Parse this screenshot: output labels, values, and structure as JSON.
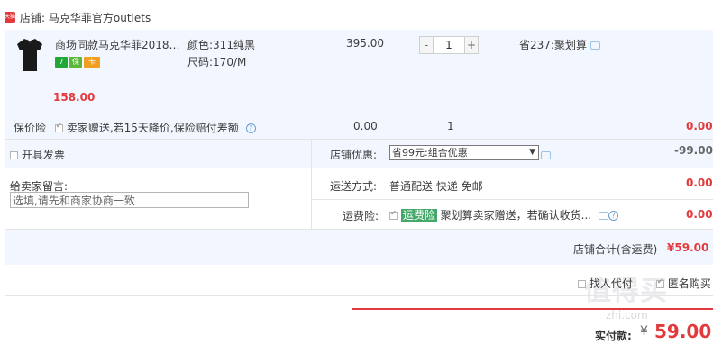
{
  "shop": {
    "icon_text": "天猫",
    "prefix": "店铺:",
    "name": "马克华菲官方outlets"
  },
  "item": {
    "title": "商场同款马克华菲2018夏...",
    "color_label": "颜色:",
    "color_value": "311纯黑",
    "size_label": "尺码:",
    "size_value": "170/M",
    "unit_price": "395.00",
    "qty_minus": "-",
    "qty_value": "1",
    "qty_plus": "+",
    "promo": "省237:聚划算",
    "subtotal": "158.00",
    "badges": [
      {
        "text": "7",
        "color": "#21a836"
      },
      {
        "text": "保",
        "color": "#5db73b"
      },
      {
        "text": "卡",
        "color": "#f0a020"
      }
    ]
  },
  "insurance": {
    "label": "保价险",
    "desc": "卖家赠送,若15天降价,保险赔付差额",
    "price": "0.00",
    "qty": "1",
    "amount": "0.00"
  },
  "invoice": {
    "label": "开具发票"
  },
  "discount": {
    "label": "店铺优惠:",
    "selected": "省99元:组合优惠",
    "amount": "-99.00"
  },
  "note": {
    "label": "给卖家留言:",
    "placeholder": "选填,请先和商家协商一致"
  },
  "shipping": {
    "label": "运送方式:",
    "method": "普通配送 快递 免邮",
    "amount": "0.00"
  },
  "freight_insurance": {
    "label": "运费险:",
    "tag": "运费险",
    "desc": "聚划算卖家赠送，若确认收货...",
    "amount": "0.00"
  },
  "shop_total": {
    "label": "店铺合计(含运费)",
    "amount": "¥59.00"
  },
  "options": {
    "proxy_pay": "找人代付",
    "anonymous": "匿名购买"
  },
  "grand_total": {
    "label": "实付款:",
    "currency": "¥",
    "amount": "59.00"
  },
  "colors": {
    "accent_red": "#e4393c",
    "band_blue": "#f2f7ff"
  }
}
